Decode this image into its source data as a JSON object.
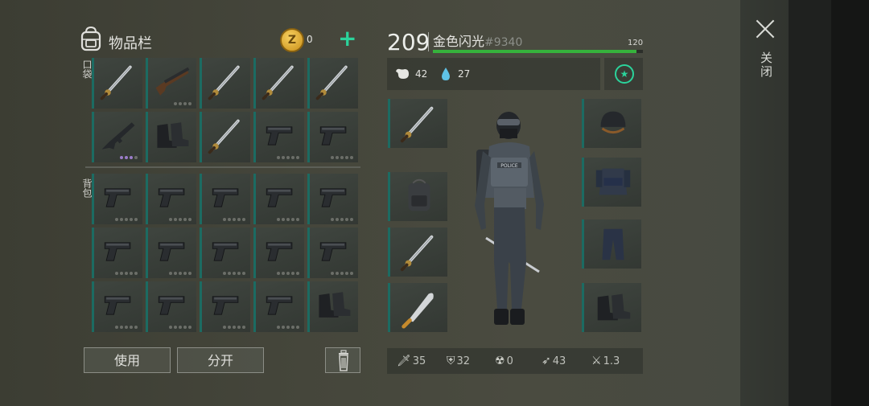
{
  "inventory": {
    "title": "物品栏",
    "coins": "0",
    "coin_symbol": "Z",
    "add_label": "+",
    "pocket_label": "口袋",
    "backpack_label": "背包",
    "use_label": "使用",
    "split_label": "分开",
    "pocket_slots": [
      "katana",
      "shotgun",
      "katana",
      "katana",
      "katana",
      "assault-rifle",
      "boots",
      "katana",
      "pistol",
      "pistol"
    ],
    "backpack_slots": [
      "pistol",
      "pistol",
      "pistol",
      "pistol",
      "pistol",
      "pistol",
      "pistol",
      "pistol",
      "pistol",
      "pistol",
      "pistol",
      "pistol",
      "pistol",
      "pistol",
      "boots"
    ]
  },
  "player": {
    "level": "209",
    "name": "金色闪光",
    "id": "#9340",
    "xp_max": "120",
    "xp_fraction": 0.97,
    "food": "42",
    "water": "27"
  },
  "equipment": {
    "left": [
      "katana",
      "backpack",
      "katana",
      "machete"
    ],
    "right": [
      "helmet",
      "police-vest",
      "pants",
      "boots"
    ],
    "vest_text": "POLICE"
  },
  "stats": [
    {
      "icon": "sword-icon",
      "value": "35"
    },
    {
      "icon": "shield-icon",
      "value": "32"
    },
    {
      "icon": "radiation-icon",
      "value": "0"
    },
    {
      "icon": "run-icon",
      "value": "43"
    },
    {
      "icon": "attack-speed-icon",
      "value": "1.3"
    }
  ],
  "close_label": "关闭",
  "colors": {
    "accent": "#2bd39b",
    "xp": "#36b23c",
    "slot_edge": "#1c6b62"
  }
}
